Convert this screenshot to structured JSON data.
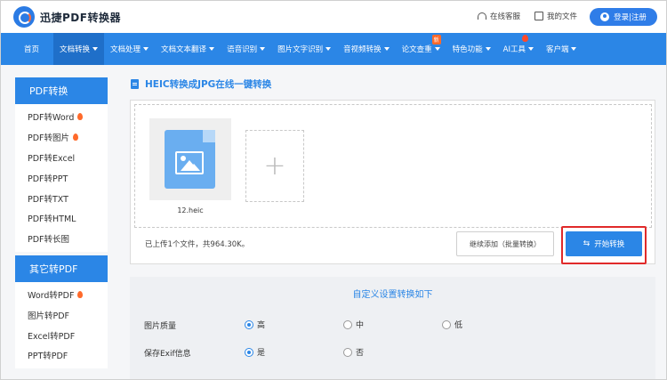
{
  "header": {
    "logo_text": "迅捷PDF转换器",
    "online_service": "在线客服",
    "my_files": "我的文件",
    "login": "登录|注册"
  },
  "nav": {
    "items": [
      {
        "label": "首页",
        "arrow": false
      },
      {
        "label": "文档转换",
        "arrow": true,
        "active": true
      },
      {
        "label": "文档处理",
        "arrow": true
      },
      {
        "label": "文档文本翻译",
        "arrow": true
      },
      {
        "label": "语音识别",
        "arrow": true
      },
      {
        "label": "图片文字识别",
        "arrow": true
      },
      {
        "label": "音视频转换",
        "arrow": true
      },
      {
        "label": "论文查重",
        "arrow": true,
        "badge": "新"
      },
      {
        "label": "特色功能",
        "arrow": true
      },
      {
        "label": "AI工具",
        "arrow": true,
        "flame": true
      },
      {
        "label": "客户端",
        "arrow": true
      }
    ]
  },
  "sidebar": {
    "section1_title": "PDF转换",
    "section1_items": [
      {
        "label": "PDF转Word",
        "hot": true
      },
      {
        "label": "PDF转图片",
        "hot": true
      },
      {
        "label": "PDF转Excel",
        "hot": false
      },
      {
        "label": "PDF转PPT",
        "hot": false
      },
      {
        "label": "PDF转TXT",
        "hot": false
      },
      {
        "label": "PDF转HTML",
        "hot": false
      },
      {
        "label": "PDF转长图",
        "hot": false
      }
    ],
    "section2_title": "其它转PDF",
    "section2_items": [
      {
        "label": "Word转PDF",
        "hot": true
      },
      {
        "label": "图片转PDF",
        "hot": false
      },
      {
        "label": "Excel转PDF",
        "hot": false
      },
      {
        "label": "PPT转PDF",
        "hot": false
      }
    ]
  },
  "main": {
    "title": "HEIC转换成JPG在线一键转换",
    "file_name": "12.heic",
    "add_symbol": "+",
    "status": "已上传1个文件，共964.30K。",
    "continue_btn": "继续添加（批量转换）",
    "start_btn": "开始转换"
  },
  "settings": {
    "title": "自定义设置转换如下",
    "quality_label": "图片质量",
    "quality_options": [
      "高",
      "中",
      "低"
    ],
    "quality_selected": "高",
    "exif_label": "保存Exif信息",
    "exif_options": [
      "是",
      "否"
    ],
    "exif_selected": "是"
  },
  "colors": {
    "primary": "#2b86e6",
    "nav_active": "#1f6fc9",
    "highlight_outline": "#e02a2a",
    "hot": "#ff6a2b"
  }
}
